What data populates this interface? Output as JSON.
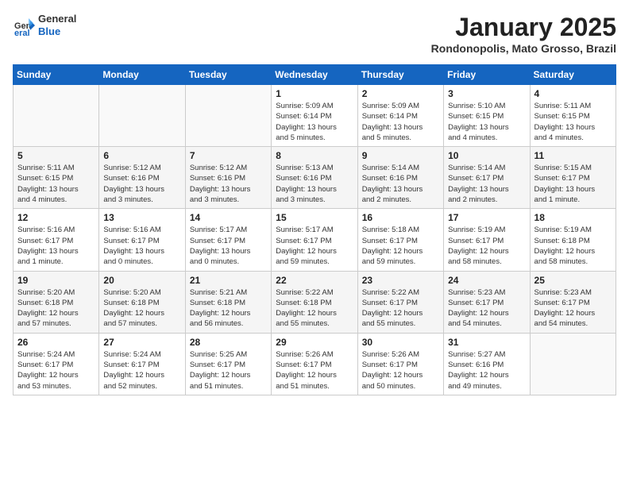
{
  "header": {
    "logo_general": "General",
    "logo_blue": "Blue",
    "month_title": "January 2025",
    "location": "Rondonopolis, Mato Grosso, Brazil"
  },
  "days_of_week": [
    "Sunday",
    "Monday",
    "Tuesday",
    "Wednesday",
    "Thursday",
    "Friday",
    "Saturday"
  ],
  "weeks": [
    [
      {
        "day": "",
        "info": ""
      },
      {
        "day": "",
        "info": ""
      },
      {
        "day": "",
        "info": ""
      },
      {
        "day": "1",
        "info": "Sunrise: 5:09 AM\nSunset: 6:14 PM\nDaylight: 13 hours\nand 5 minutes."
      },
      {
        "day": "2",
        "info": "Sunrise: 5:09 AM\nSunset: 6:14 PM\nDaylight: 13 hours\nand 5 minutes."
      },
      {
        "day": "3",
        "info": "Sunrise: 5:10 AM\nSunset: 6:15 PM\nDaylight: 13 hours\nand 4 minutes."
      },
      {
        "day": "4",
        "info": "Sunrise: 5:11 AM\nSunset: 6:15 PM\nDaylight: 13 hours\nand 4 minutes."
      }
    ],
    [
      {
        "day": "5",
        "info": "Sunrise: 5:11 AM\nSunset: 6:15 PM\nDaylight: 13 hours\nand 4 minutes."
      },
      {
        "day": "6",
        "info": "Sunrise: 5:12 AM\nSunset: 6:16 PM\nDaylight: 13 hours\nand 3 minutes."
      },
      {
        "day": "7",
        "info": "Sunrise: 5:12 AM\nSunset: 6:16 PM\nDaylight: 13 hours\nand 3 minutes."
      },
      {
        "day": "8",
        "info": "Sunrise: 5:13 AM\nSunset: 6:16 PM\nDaylight: 13 hours\nand 3 minutes."
      },
      {
        "day": "9",
        "info": "Sunrise: 5:14 AM\nSunset: 6:16 PM\nDaylight: 13 hours\nand 2 minutes."
      },
      {
        "day": "10",
        "info": "Sunrise: 5:14 AM\nSunset: 6:17 PM\nDaylight: 13 hours\nand 2 minutes."
      },
      {
        "day": "11",
        "info": "Sunrise: 5:15 AM\nSunset: 6:17 PM\nDaylight: 13 hours\nand 1 minute."
      }
    ],
    [
      {
        "day": "12",
        "info": "Sunrise: 5:16 AM\nSunset: 6:17 PM\nDaylight: 13 hours\nand 1 minute."
      },
      {
        "day": "13",
        "info": "Sunrise: 5:16 AM\nSunset: 6:17 PM\nDaylight: 13 hours\nand 0 minutes."
      },
      {
        "day": "14",
        "info": "Sunrise: 5:17 AM\nSunset: 6:17 PM\nDaylight: 13 hours\nand 0 minutes."
      },
      {
        "day": "15",
        "info": "Sunrise: 5:17 AM\nSunset: 6:17 PM\nDaylight: 12 hours\nand 59 minutes."
      },
      {
        "day": "16",
        "info": "Sunrise: 5:18 AM\nSunset: 6:17 PM\nDaylight: 12 hours\nand 59 minutes."
      },
      {
        "day": "17",
        "info": "Sunrise: 5:19 AM\nSunset: 6:17 PM\nDaylight: 12 hours\nand 58 minutes."
      },
      {
        "day": "18",
        "info": "Sunrise: 5:19 AM\nSunset: 6:18 PM\nDaylight: 12 hours\nand 58 minutes."
      }
    ],
    [
      {
        "day": "19",
        "info": "Sunrise: 5:20 AM\nSunset: 6:18 PM\nDaylight: 12 hours\nand 57 minutes."
      },
      {
        "day": "20",
        "info": "Sunrise: 5:20 AM\nSunset: 6:18 PM\nDaylight: 12 hours\nand 57 minutes."
      },
      {
        "day": "21",
        "info": "Sunrise: 5:21 AM\nSunset: 6:18 PM\nDaylight: 12 hours\nand 56 minutes."
      },
      {
        "day": "22",
        "info": "Sunrise: 5:22 AM\nSunset: 6:18 PM\nDaylight: 12 hours\nand 55 minutes."
      },
      {
        "day": "23",
        "info": "Sunrise: 5:22 AM\nSunset: 6:17 PM\nDaylight: 12 hours\nand 55 minutes."
      },
      {
        "day": "24",
        "info": "Sunrise: 5:23 AM\nSunset: 6:17 PM\nDaylight: 12 hours\nand 54 minutes."
      },
      {
        "day": "25",
        "info": "Sunrise: 5:23 AM\nSunset: 6:17 PM\nDaylight: 12 hours\nand 54 minutes."
      }
    ],
    [
      {
        "day": "26",
        "info": "Sunrise: 5:24 AM\nSunset: 6:17 PM\nDaylight: 12 hours\nand 53 minutes."
      },
      {
        "day": "27",
        "info": "Sunrise: 5:24 AM\nSunset: 6:17 PM\nDaylight: 12 hours\nand 52 minutes."
      },
      {
        "day": "28",
        "info": "Sunrise: 5:25 AM\nSunset: 6:17 PM\nDaylight: 12 hours\nand 51 minutes."
      },
      {
        "day": "29",
        "info": "Sunrise: 5:26 AM\nSunset: 6:17 PM\nDaylight: 12 hours\nand 51 minutes."
      },
      {
        "day": "30",
        "info": "Sunrise: 5:26 AM\nSunset: 6:17 PM\nDaylight: 12 hours\nand 50 minutes."
      },
      {
        "day": "31",
        "info": "Sunrise: 5:27 AM\nSunset: 6:16 PM\nDaylight: 12 hours\nand 49 minutes."
      },
      {
        "day": "",
        "info": ""
      }
    ]
  ]
}
